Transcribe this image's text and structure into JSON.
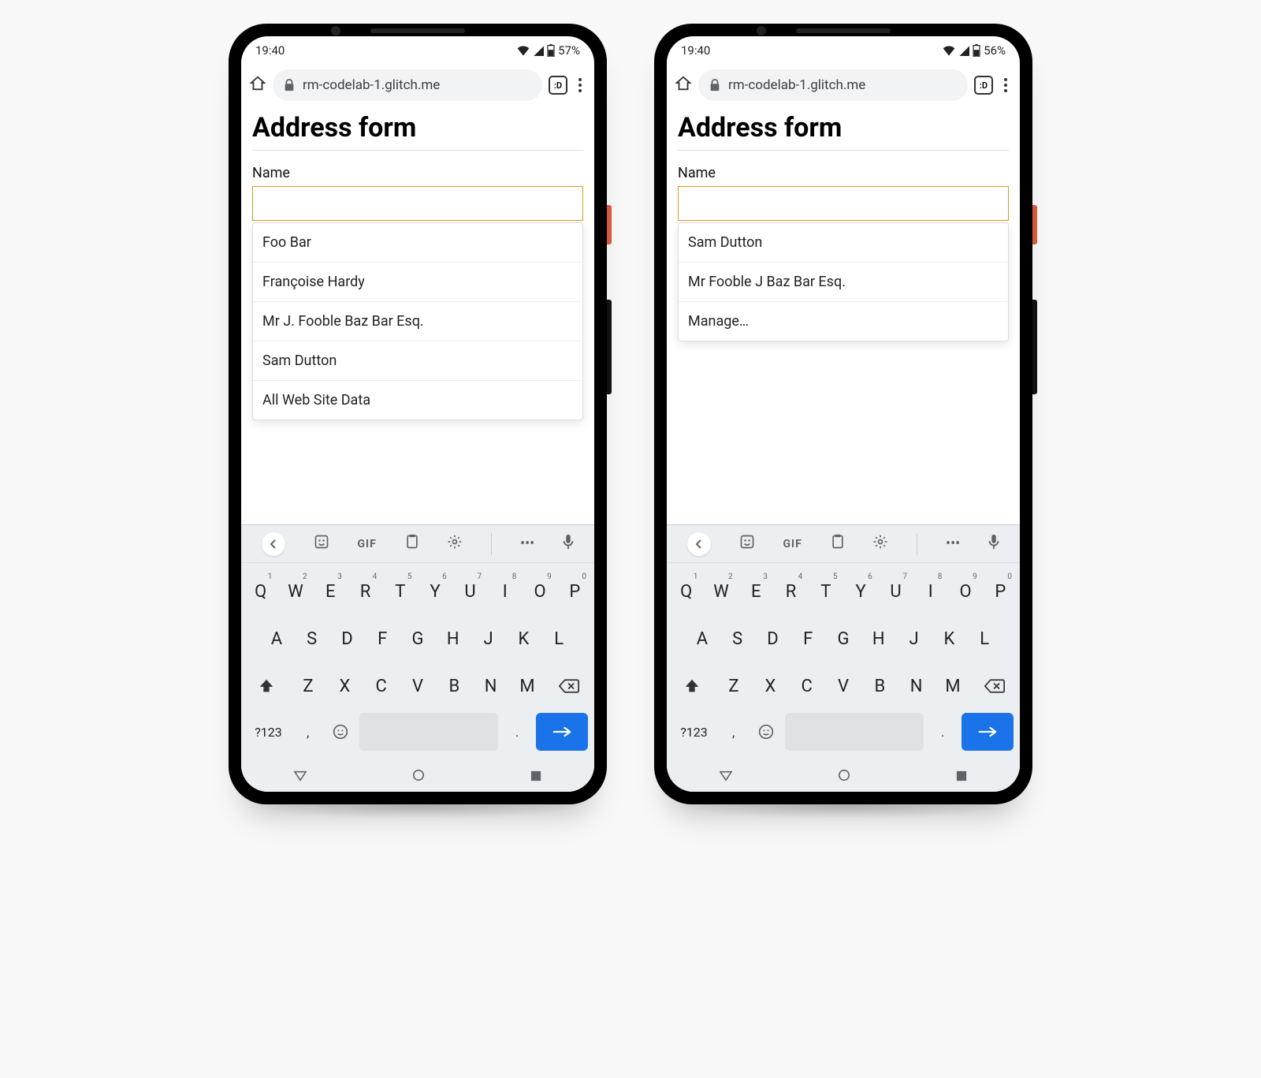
{
  "phones": [
    {
      "status": {
        "time": "19:40",
        "battery": "57%"
      },
      "browser": {
        "url": "rm-codelab-1.glitch.me",
        "tab_marker": ":D"
      },
      "page": {
        "title": "Address form",
        "name_label": "Name",
        "name_value": "",
        "suggestions": [
          "Foo Bar",
          "Françoise Hardy",
          "Mr J. Fooble Baz Bar Esq.",
          "Sam Dutton",
          "All Web Site Data"
        ]
      }
    },
    {
      "status": {
        "time": "19:40",
        "battery": "56%"
      },
      "browser": {
        "url": "rm-codelab-1.glitch.me",
        "tab_marker": ":D"
      },
      "page": {
        "title": "Address form",
        "name_label": "Name",
        "name_value": "",
        "suggestions": [
          "Sam Dutton",
          "Mr Fooble J Baz Bar Esq.",
          "Manage…"
        ]
      }
    }
  ],
  "keyboard": {
    "toolbar": {
      "gif": "GIF"
    },
    "rows": {
      "r1": [
        "Q",
        "W",
        "E",
        "R",
        "T",
        "Y",
        "U",
        "I",
        "O",
        "P"
      ],
      "r1_sup": [
        "1",
        "2",
        "3",
        "4",
        "5",
        "6",
        "7",
        "8",
        "9",
        "0"
      ],
      "r2": [
        "A",
        "S",
        "D",
        "F",
        "G",
        "H",
        "J",
        "K",
        "L"
      ],
      "r3": [
        "Z",
        "X",
        "C",
        "V",
        "B",
        "N",
        "M"
      ],
      "r4": {
        "symbols": "?123",
        "comma": ",",
        "period": "."
      }
    }
  }
}
